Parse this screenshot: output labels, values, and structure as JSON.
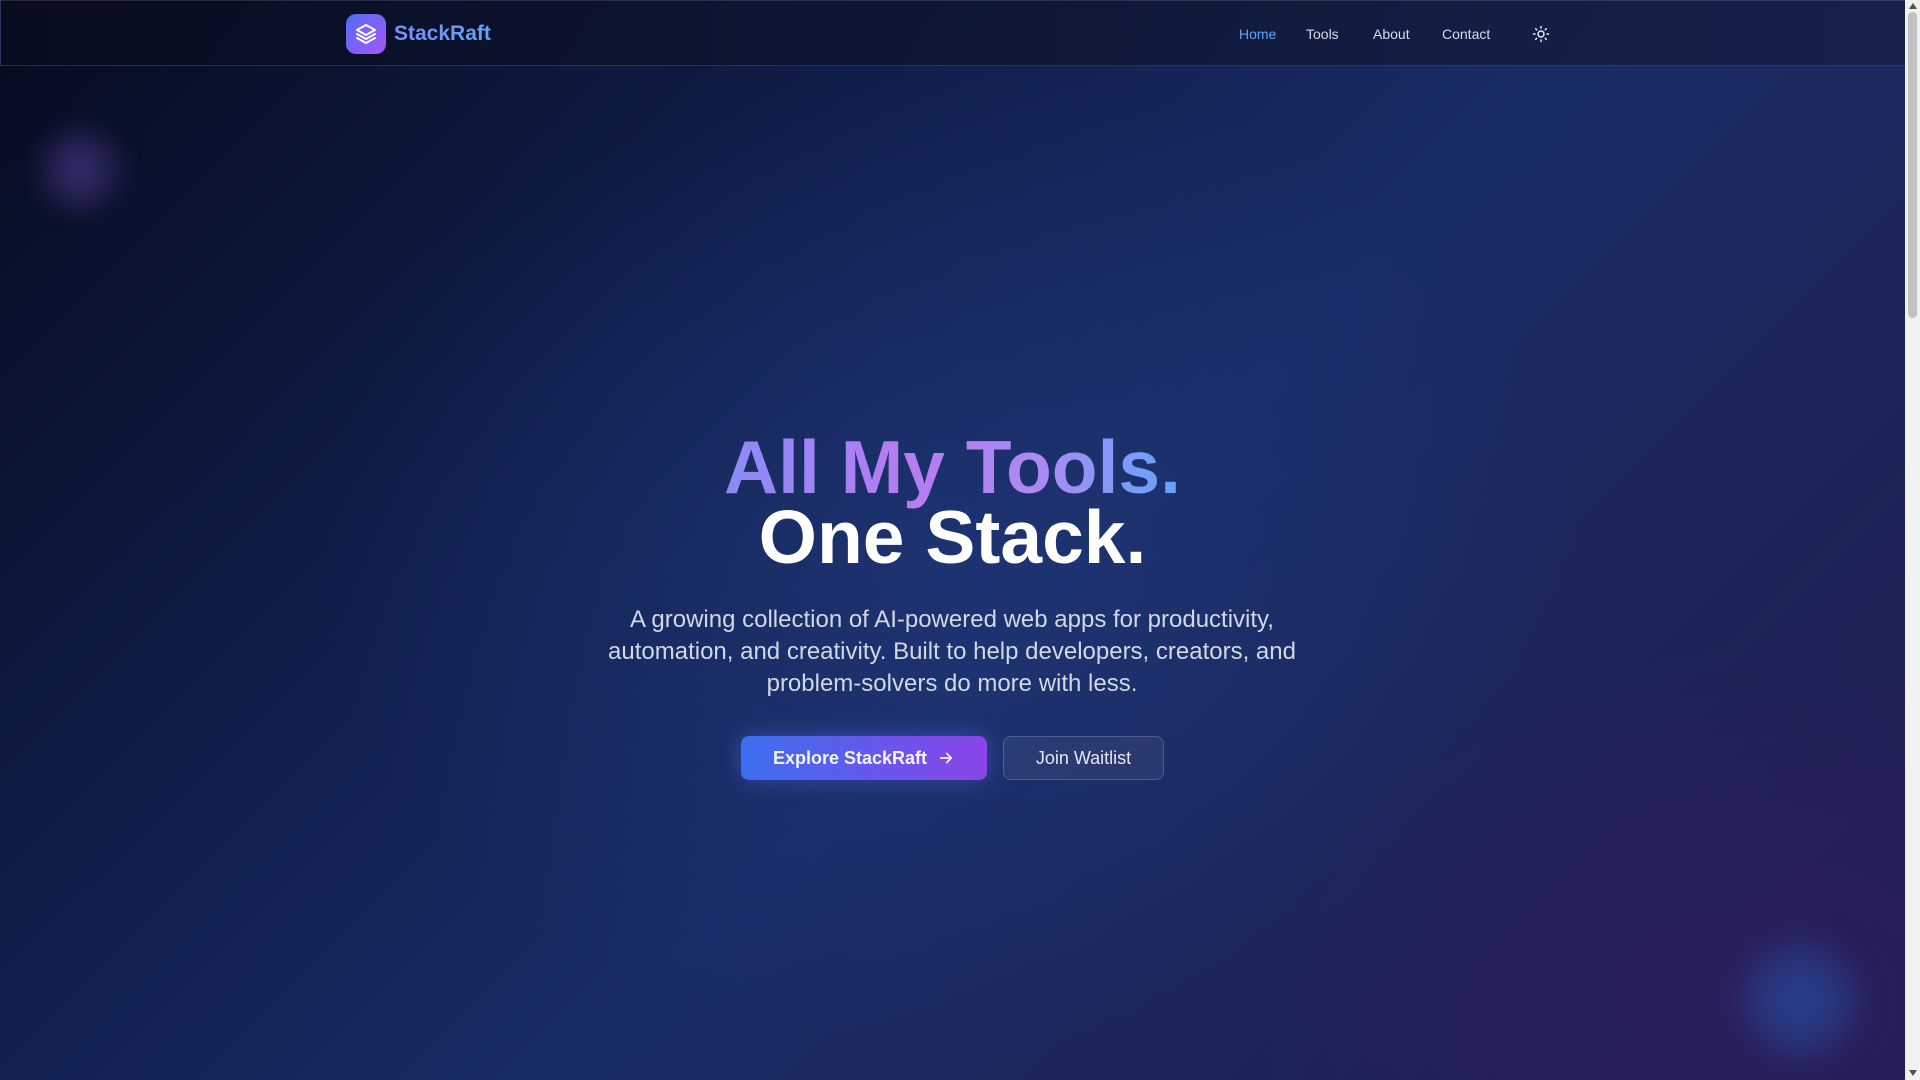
{
  "brand": {
    "name": "StackRaft",
    "logo_icon": "layers-icon",
    "accent_from": "#4f6ef5",
    "accent_to": "#a855f7"
  },
  "nav": {
    "items": [
      {
        "label": "Home",
        "active": true
      },
      {
        "label": "Tools",
        "active": false
      },
      {
        "label": "About",
        "active": false
      },
      {
        "label": "Contact",
        "active": false
      }
    ],
    "theme_toggle_icon": "sun-icon"
  },
  "hero": {
    "title_line1": "All My Tools.",
    "title_line2": "One Stack.",
    "subtitle": "A growing collection of AI-powered web apps for productivity, automation, and creativity. Built to help developers, creators, and problem-solvers do more with less.",
    "primary_button": {
      "label": "Explore StackRaft",
      "icon": "arrow-right-icon"
    },
    "secondary_button": {
      "label": "Join Waitlist"
    }
  },
  "colors": {
    "active_nav": "#60a5fa",
    "background_dark": "#0f1d48"
  }
}
